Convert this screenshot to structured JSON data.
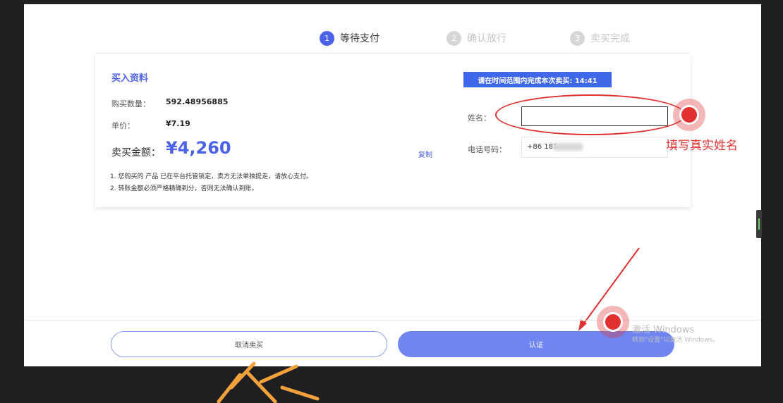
{
  "steps": [
    {
      "num": "1",
      "label": "等待支付",
      "state": "active"
    },
    {
      "num": "2",
      "label": "确认放行",
      "state": "inactive"
    },
    {
      "num": "3",
      "label": "卖买完成",
      "state": "inactive"
    }
  ],
  "order": {
    "title": "买入资料",
    "qty_label": "购买数量：",
    "qty_value": "592.48956885",
    "price_label": "单价：",
    "price_value": "¥7.19",
    "total_label": "卖买金额：",
    "total_value": "¥4,260",
    "copy_label": "复制",
    "note1": "1. 您购买的 产品 已在平台托管锁定，卖方无法单独提走，请放心支付。",
    "note2": "2. 转账金额必须严格精确到分，否则无法确认到账。"
  },
  "payment": {
    "timer_text": "请在时间范围内完成本次卖买: 14:41",
    "name_label": "姓名：",
    "name_value": "",
    "phone_label": "电话号码：",
    "phone_value": "+86 181"
  },
  "annotation": {
    "text": "填写真实姓名"
  },
  "footer": {
    "cancel_label": "取消卖买",
    "confirm_label": "认证"
  },
  "windows_watermark": {
    "line1": "激活 Windows",
    "line2": "转到\"设置\"以激活 Windows。"
  },
  "colors": {
    "accent": "#4c63e8",
    "annotation": "#e03030",
    "confirm_button": "#6f86f2"
  }
}
